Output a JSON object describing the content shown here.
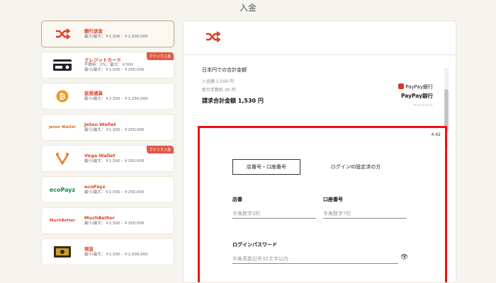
{
  "page_title": "入金",
  "methods": [
    {
      "name": "銀行送金",
      "line1": "最小/最大：￥1,500 - ￥1,000,000",
      "line2": "",
      "badge": "",
      "icon": "shuffle-icon",
      "active": true
    },
    {
      "name": "クレジットカード",
      "line1": "手数料：2%，最大：￥500",
      "line2": "最小/最大：￥1,500 - ￥250,000",
      "badge": "クイック入金",
      "icon": "credit-card-icon",
      "active": false
    },
    {
      "name": "仮想通貨",
      "line1": "最小/最大：￥2,500 - ￥1,250,000",
      "line2": "",
      "badge": "",
      "icon": "bitcoin-icon",
      "active": false
    },
    {
      "name": "Jeton Wallet",
      "line1": "最小/最大：￥1,500 - ￥250,000",
      "line2": "",
      "badge": "",
      "icon": "jeton-logo",
      "logo_text": "Jeton Wallet",
      "active": false
    },
    {
      "name": "Vega Wallet",
      "line1": "最小/最大：￥1,500 - ￥250,000",
      "line2": "",
      "badge": "クイック入金",
      "icon": "vega-logo",
      "active": false
    },
    {
      "name": "ecoPayz",
      "line1": "最小/最大：￥1,500 - ￥250,000",
      "line2": "",
      "badge": "",
      "icon": "ecopayz-logo",
      "logo_text": "ecoPayz",
      "active": false
    },
    {
      "name": "MuchBetter",
      "line1": "最小/最大：￥1,500 - ￥250,000",
      "line2": "",
      "badge": "",
      "icon": "muchbetter-logo",
      "logo_text": "MuchBetter",
      "active": false
    },
    {
      "name": "現金",
      "line1": "最小/最大：￥1,500 - ￥1,000,000",
      "line2": "",
      "badge": "",
      "icon": "cash-icon",
      "active": false
    }
  ],
  "summary": {
    "heading": "日本円での合計金額",
    "deposit": "入金額 1,500 円",
    "fee": "取引手数料 30 円",
    "total": "請求合計金額 1,530 円"
  },
  "paypay": {
    "brand": "PayPay",
    "brand_suffix": "銀行",
    "bank_name": "PayPay銀行"
  },
  "form": {
    "timer": "4:42",
    "tab_active": "店番号・口座番号",
    "tab_inactive": "ログインID設定済の方",
    "branch_label": "店番",
    "branch_placeholder": "半角数字3桁",
    "account_label": "口座番号",
    "account_placeholder": "半角数字7桁",
    "password_label": "ログインパスワード",
    "password_placeholder": "半角英数記号32文字以内"
  },
  "colors": {
    "accent": "#d9412c",
    "frame": "#ee1111",
    "badge": "#e05a48"
  }
}
